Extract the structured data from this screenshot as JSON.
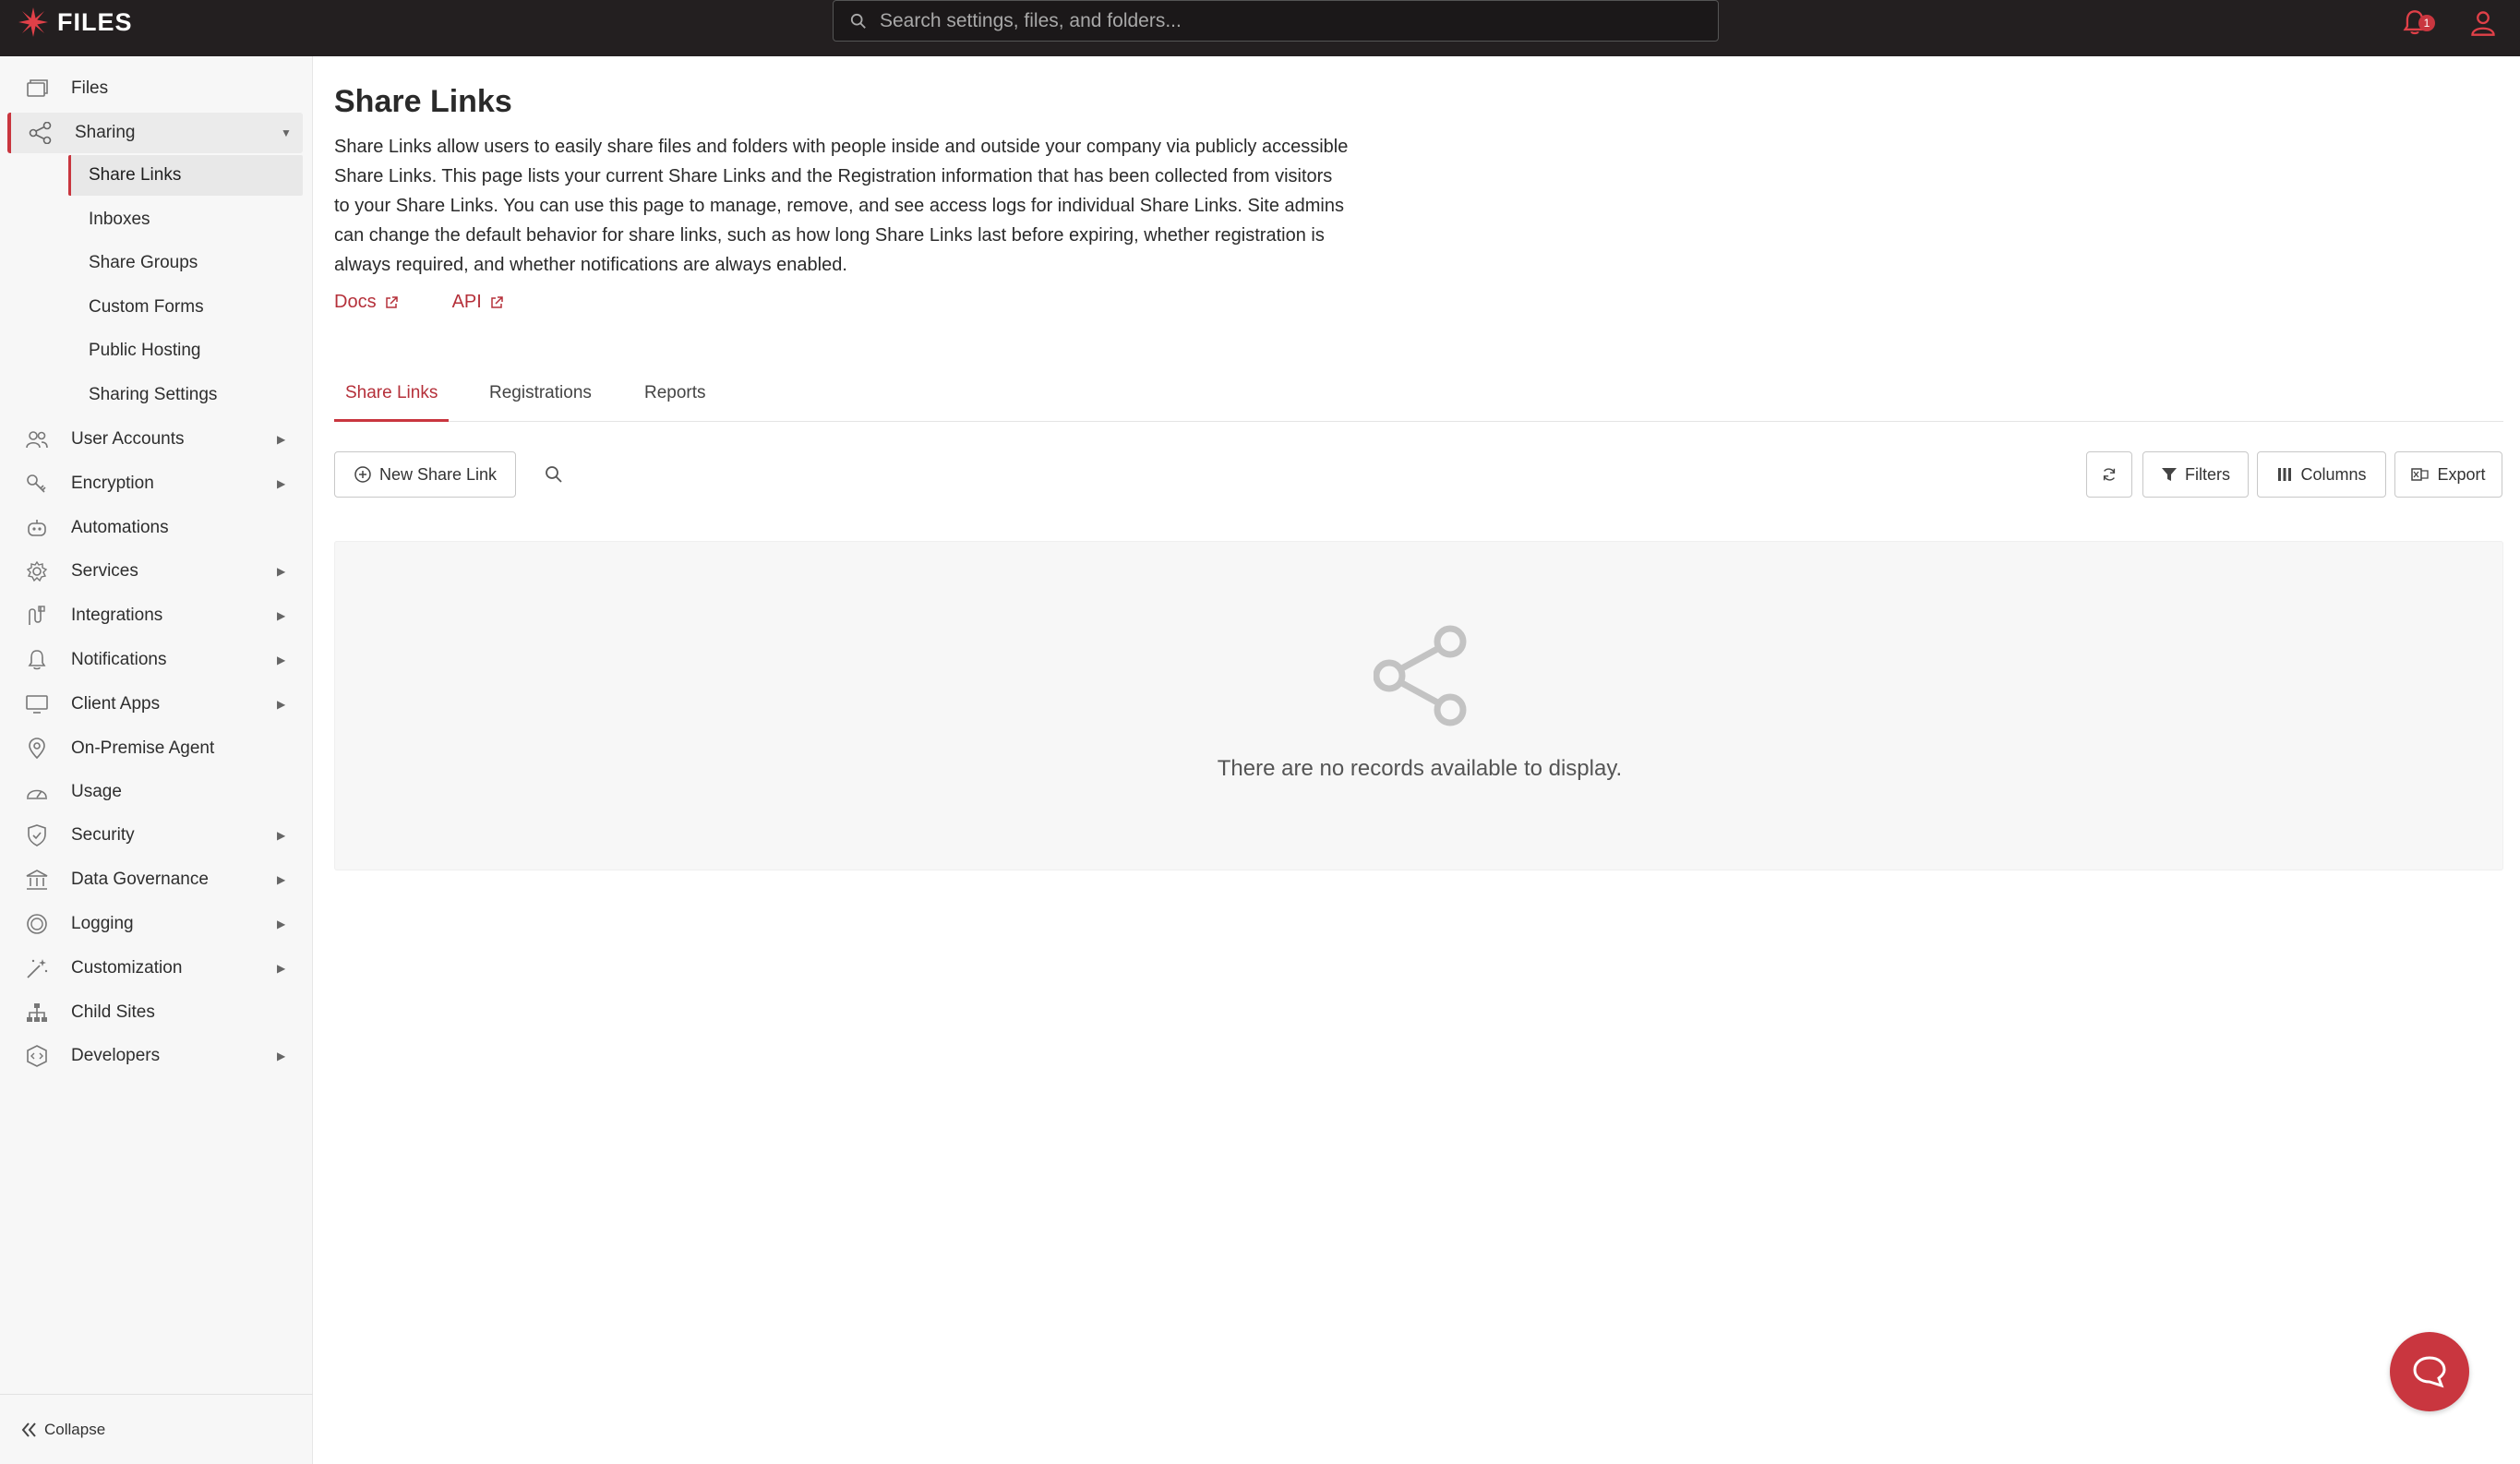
{
  "app": {
    "logo_text": "FILES",
    "accent": "#c9363f"
  },
  "search": {
    "placeholder": "Search settings, files, and folders..."
  },
  "header": {
    "notification_count": "1"
  },
  "sidebar": {
    "items": [
      {
        "label": "Files",
        "icon": "files-icon"
      },
      {
        "label": "Sharing",
        "icon": "share-icon",
        "expanded": true
      },
      {
        "label": "User Accounts",
        "icon": "users-icon"
      },
      {
        "label": "Encryption",
        "icon": "key-icon"
      },
      {
        "label": "Automations",
        "icon": "robot-icon"
      },
      {
        "label": "Services",
        "icon": "gear-icon"
      },
      {
        "label": "Integrations",
        "icon": "integrations-icon"
      },
      {
        "label": "Notifications",
        "icon": "bell-icon"
      },
      {
        "label": "Client Apps",
        "icon": "monitor-icon"
      },
      {
        "label": "On-Premise Agent",
        "icon": "location-pin-icon"
      },
      {
        "label": "Usage",
        "icon": "gauge-icon"
      },
      {
        "label": "Security",
        "icon": "shield-icon"
      },
      {
        "label": "Data Governance",
        "icon": "bank-icon"
      },
      {
        "label": "Logging",
        "icon": "log-icon"
      },
      {
        "label": "Customization",
        "icon": "magic-wand-icon"
      },
      {
        "label": "Child Sites",
        "icon": "sitemap-icon"
      },
      {
        "label": "Developers",
        "icon": "code-icon"
      }
    ],
    "sharing_children": [
      "Share Links",
      "Inboxes",
      "Share Groups",
      "Custom Forms",
      "Public Hosting",
      "Sharing Settings"
    ],
    "collapse_label": "Collapse"
  },
  "main": {
    "title": "Share Links",
    "description": "Share Links allow users to easily share files and folders with people inside and outside your company via publicly accessible Share Links. This page lists your current Share Links and the Registration information that has been collected from visitors to your Share Links. You can use this page to manage, remove, and see access logs for individual Share Links. Site admins can change the default behavior for share links, such as how long Share Links last before expiring, whether registration is always required, and whether notifications are always enabled.",
    "links": {
      "docs": "Docs",
      "api": "API"
    },
    "tabs": [
      "Share Links",
      "Registrations",
      "Reports"
    ],
    "toolbar": {
      "new_button": "New Share Link",
      "filters": "Filters",
      "columns": "Columns",
      "export": "Export"
    },
    "empty_message": "There are no records available to display."
  }
}
